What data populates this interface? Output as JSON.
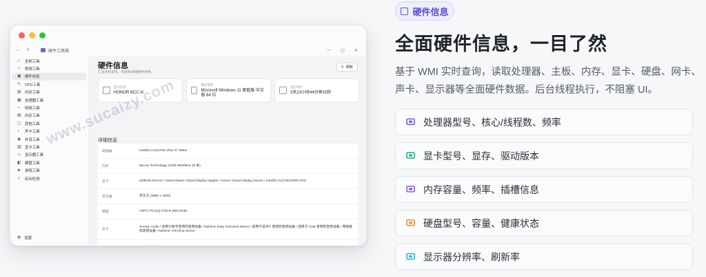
{
  "window": {
    "app_name": "硬件工具箱",
    "sidebar": [
      {
        "label": "全部工具",
        "icon": "home-icon"
      },
      {
        "label": "常用工具",
        "icon": "star-icon"
      },
      {
        "label": "硬件信息",
        "icon": "chip-icon",
        "active": true
      },
      {
        "label": "CPU工具",
        "icon": "pen-icon"
      },
      {
        "label": "内存工具",
        "icon": "memory-icon"
      },
      {
        "label": "处理器工具",
        "icon": "cpu-icon"
      },
      {
        "label": "网络工具",
        "icon": "network-icon"
      },
      {
        "label": "内存工具",
        "icon": "memory-icon"
      },
      {
        "label": "其他工具",
        "icon": "box-icon"
      },
      {
        "label": "声卡工具",
        "icon": "speaker-icon"
      },
      {
        "label": "外设工具",
        "icon": "mouse-icon"
      },
      {
        "label": "显卡工具",
        "icon": "gpu-icon"
      },
      {
        "label": "显示器工具",
        "icon": "monitor-icon"
      },
      {
        "label": "硬盘工具",
        "icon": "disk-icon"
      },
      {
        "label": "游戏工具",
        "icon": "game-icon"
      },
      {
        "label": "综合检测",
        "icon": "check-icon"
      }
    ],
    "settings_label": "设置",
    "page_title": "硬件信息",
    "page_subtitle": "汇总本机型号、系统和关键硬件参数。",
    "refresh_label": "刷新",
    "cards": [
      {
        "label": "型号信息",
        "value": "HONOR BCC-N"
      },
      {
        "label": "操作系统",
        "value": "Microsoft Windows 11 家庭版 中文版 64 位"
      },
      {
        "label": "运行时间",
        "value": "3天23小时44分钟15秒"
      }
    ],
    "detail_title": "详细信息",
    "details": [
      {
        "key": "处理器",
        "value": "Intel(R) Core(TM) Ultra X7 358H",
        "h": 22
      },
      {
        "key": "内存",
        "value": "Micron Technology 32GB 9600MHz (8 条)",
        "h": 22
      },
      {
        "key": "显卡",
        "value": "IddDesk Device / GameViewer Virtual Display Adapter / Honor Virtual Display Device / Intel(R) Arc(TM) B390 GPU",
        "h": 22
      },
      {
        "key": "显示器",
        "value": "京东方 (2880 x 1800)",
        "h": 22
      },
      {
        "key": "硬盘",
        "value": "YMTC PC41Q-1TB-B (953.9GB)",
        "h": 22
      },
      {
        "key": "声卡",
        "value": "Senary Audio / 适用于数字音频的音频设备 / Nahimic Easy Surround device / 适用于蓝牙® 音频的音频设备 / 适用于 USB 音频的音频设备 / 网络虚拟音频设备 / Nahimic mirroring device",
        "h": 30
      },
      {
        "key": "网卡",
        "value": "Intel(R) Wi-Fi 6E AX211 160MHz",
        "h": 22
      }
    ],
    "watermark": "www.sucaizy.com"
  },
  "panel": {
    "badge": "硬件信息",
    "headline": "全面硬件信息，一目了然",
    "description": "基于 WMI 实时查询，读取处理器、主板、内存、显卡、硬盘、网卡、声卡、显示器等全面硬件数据。后台线程执行，不阻塞 UI。",
    "features": [
      {
        "label": "处理器型号、核心/线程数、频率",
        "icon": "chip-icon",
        "color": "#6a5cd6"
      },
      {
        "label": "显卡型号、显存、驱动版本",
        "icon": "monitor-icon",
        "color": "#19b07a"
      },
      {
        "label": "内存容量、频率、插槽信息",
        "icon": "memory-icon",
        "color": "#8a56e8"
      },
      {
        "label": "硬盘型号、容量、健康状态",
        "icon": "disk-icon",
        "color": "#f08a2a"
      },
      {
        "label": "显示器分辨率、刷新率",
        "icon": "monitor-icon",
        "color": "#1fb6d6"
      }
    ]
  }
}
